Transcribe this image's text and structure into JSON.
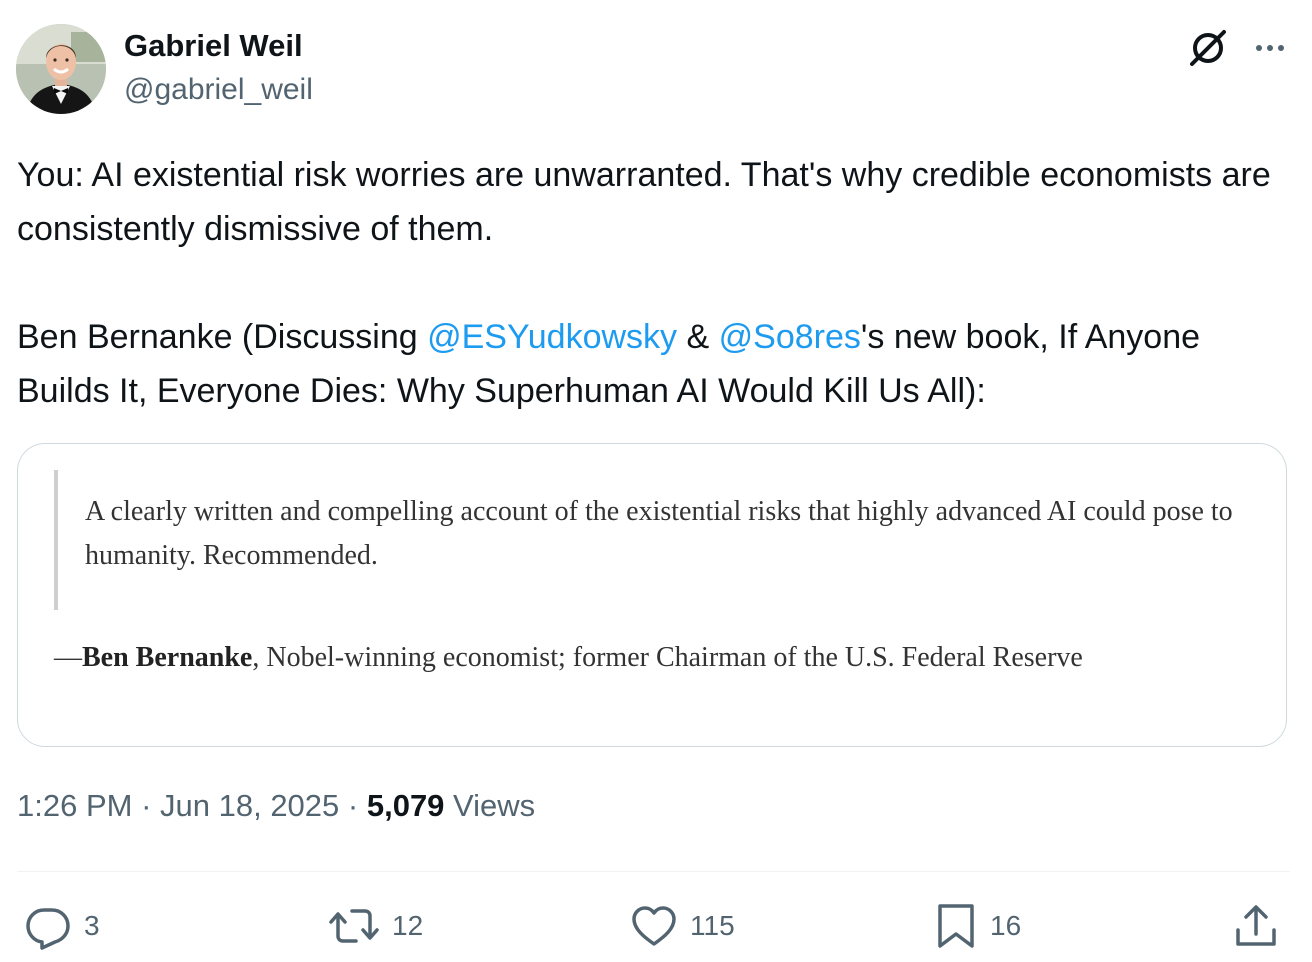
{
  "author": {
    "name": "Gabriel Weil",
    "handle": "@gabriel_weil"
  },
  "icons": {
    "grok": "grok-icon",
    "more": "more-icon",
    "reply": "reply-icon",
    "retweet": "retweet-icon",
    "like": "heart-icon",
    "bookmark": "bookmark-icon",
    "share": "share-icon"
  },
  "tweet": {
    "line1": "You: AI existential risk worries are unwarranted. That's why credible economists are consistently dismissive of them.",
    "line2_prefix": "Ben Bernanke (Discussing ",
    "mention1": "@ESYudkowsky",
    "line2_mid": " & ",
    "mention2": "@So8res",
    "line2_suffix": "'s new book, If Anyone Builds It, Everyone Dies: Why Superhuman AI Would Kill Us All):"
  },
  "quote_image": {
    "quote": "A clearly written and compelling account of the existential risks that highly advanced AI could pose to humanity. Recommended.",
    "attribution_dash": "—",
    "attribution_name": "Ben Bernanke",
    "attribution_rest": ", Nobel-winning economist; former Chairman of the U.S. Federal Reserve"
  },
  "meta": {
    "time": "1:26 PM",
    "separator": " · ",
    "date": "Jun 18, 2025",
    "views_count": "5,079",
    "views_label": " Views"
  },
  "actions": {
    "replies": "3",
    "retweets": "12",
    "likes": "115",
    "bookmarks": "16"
  },
  "colors": {
    "text": "#0f1419",
    "secondary": "#536471",
    "link": "#1d9bf0",
    "border": "#cfd9de"
  }
}
